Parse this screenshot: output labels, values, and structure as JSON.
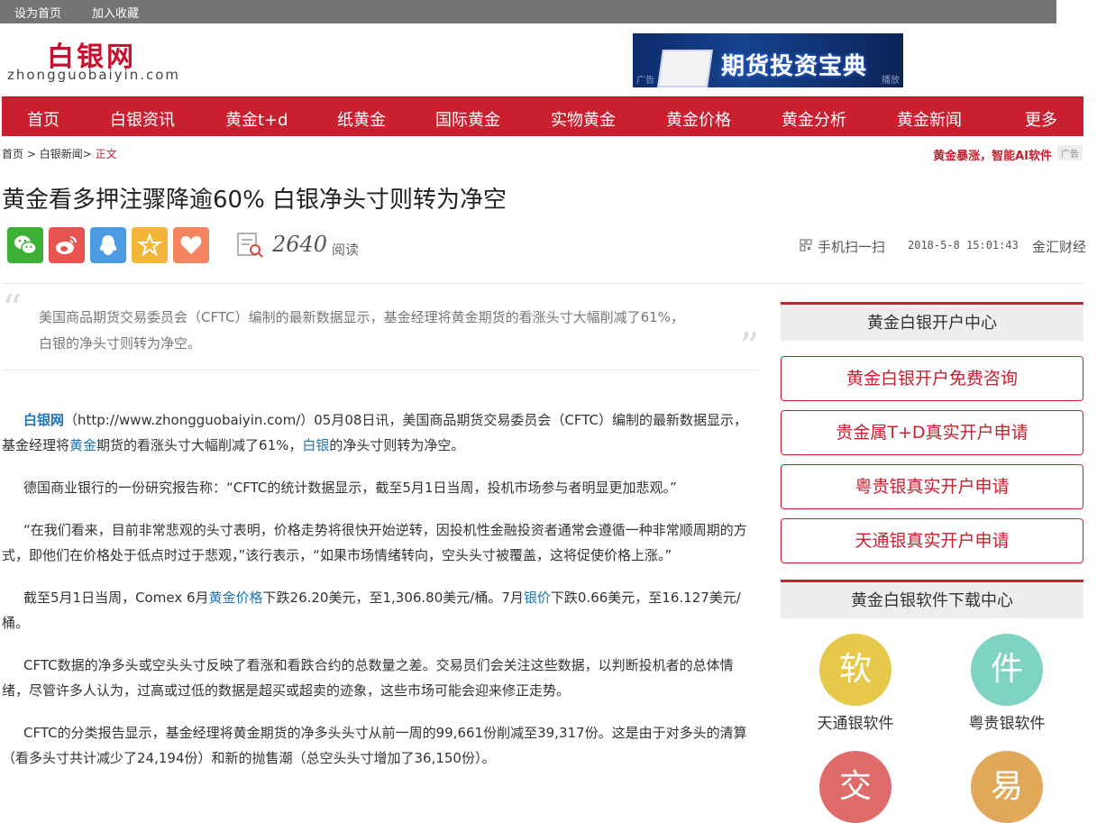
{
  "topbar": {
    "set_home": "设为首页",
    "add_favorite": "加入收藏"
  },
  "logo": {
    "name_cn": "白银网",
    "domain": "zhongguobaiyin.com"
  },
  "banner": {
    "text": "期货投资宝典",
    "ad_left": "广告",
    "ad_right": "播放"
  },
  "nav": [
    "首页",
    "白银资讯",
    "黄金t+d",
    "纸黄金",
    "国际黄金",
    "实物黄金",
    "黄金价格",
    "黄金分析",
    "黄金新闻",
    "更多"
  ],
  "breadcrumb": {
    "home": "首页",
    "sep1": " > ",
    "section": "白银新闻",
    "sep2": "> ",
    "current": "正文"
  },
  "ad_link": {
    "text": "黄金暴涨，智能AI软件",
    "tag": "广告"
  },
  "article": {
    "title": "黄金看多押注骤降逾60% 白银净头寸则转为净空",
    "read_count": "2640",
    "read_label": "阅读",
    "scan_label": "手机扫一扫",
    "date": "2018-5-8 15:01:43",
    "source": "金汇财经",
    "quote_open": "“",
    "quote_close": "”",
    "summary": "美国商品期货交易委员会（CFTC）编制的最新数据显示，基金经理将黄金期货的看涨头寸大幅削减了61%，白银的净头寸则转为净空。",
    "p1": {
      "brand": "白银网",
      "a": "（http://www.zhongguobaiyin.com/）05月08日讯，美国商品期货交易委员会（CFTC）编制的最新数据显示，基金经理将",
      "link1": "黄金",
      "b": "期货的看涨头寸大幅削减了61%，",
      "link2": "白银",
      "c": "的净头寸则转为净空。"
    },
    "p2": "德国商业银行的一份研究报告称：“CFTC的统计数据显示，截至5月1日当周，投机市场参与者明显更加悲观。”",
    "p3": "“在我们看来，目前非常悲观的头寸表明，价格走势将很快开始逆转，因投机性金融投资者通常会遵循一种非常顺周期的方式，即他们在价格处于低点时过于悲观，”该行表示，“如果市场情绪转向，空头头寸被覆盖，这将促使价格上涨。”",
    "p4": {
      "a": "截至5月1日当周，Comex 6月",
      "link1": "黄金价格",
      "b": "下跌26.20美元，至1,306.80美元/桶。7月",
      "link2": "银价",
      "c": "下跌0.66美元，至16.127美元/桶。"
    },
    "p5": "CFTC数据的净多头或空头头寸反映了看涨和看跌合约的总数量之差。交易员们会关注这些数据，以判断投机者的总体情绪，尽管许多人认为，过高或过低的数据是超买或超卖的迹象，这些市场可能会迎来修正走势。",
    "p6": "CFTC的分类报告显示，基金经理将黄金期货的净多头头寸从前一周的99,661份削减至39,317份。这是由于对多头的清算（看多头寸共计减少了24,194份）和新的抛售潮（总空头头寸增加了36,150份）。"
  },
  "sidebar": {
    "account_title": "黄金白银开户中心",
    "buttons": [
      "黄金白银开户免费咨询",
      "贵金属T+D真实开户申请",
      "粤贵银真实开户申请",
      "天通银真实开户申请"
    ],
    "software_title": "黄金白银软件下载中心",
    "software": [
      {
        "char": "软",
        "label": "天通银软件",
        "color": "#e6c84a"
      },
      {
        "char": "件",
        "label": "粤贵银软件",
        "color": "#7fd3c2"
      },
      {
        "char": "交",
        "label": "",
        "color": "#e06b6b"
      },
      {
        "char": "易",
        "label": "",
        "color": "#e2a85a"
      }
    ]
  },
  "share_colors": {
    "wechat": "#3cb034",
    "weibo": "#e8544f",
    "qq": "#4a9be0",
    "qzone": "#f4b638",
    "like": "#f5855f"
  }
}
